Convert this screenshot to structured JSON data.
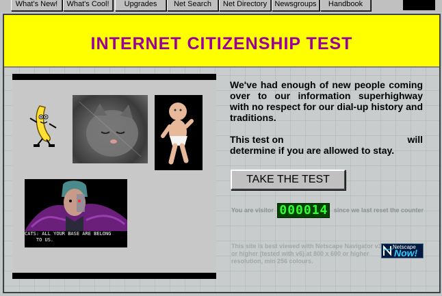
{
  "toolbar": {
    "buttons": [
      {
        "label": "What's New!"
      },
      {
        "label": "What's Cool!"
      },
      {
        "label": "Upgrades"
      },
      {
        "label": "Net Search"
      },
      {
        "label": "Net Directory"
      },
      {
        "label": "Newsgroups"
      },
      {
        "label": "Handbook"
      }
    ]
  },
  "banner": {
    "title": "INTERNET CITIZENSHIP TEST",
    "background_color": "#ffff00",
    "title_color": "#990099"
  },
  "collage": {
    "images": [
      "dancing-banana",
      "kitten",
      "dancing-baby",
      "anime-character"
    ],
    "anime_caption_line1": "CATS: ALL YOUR BASE ARE BELONG",
    "anime_caption_line2": "TO US."
  },
  "intro": {
    "paragraph1": "We've had enough of new people coming over to our information superhighway with no respect for our dial-up history and traditions.",
    "paragraph2_start": "This test on",
    "paragraph2_mid": "will",
    "paragraph2_end": "determine if you are allowed to stay."
  },
  "take_test_button": {
    "label": "TAKE THE TEST"
  },
  "visitor": {
    "prefix": "You are visitor",
    "count": "000014",
    "suffix": "since we last reset the counter"
  },
  "footer": {
    "best_viewed": "This site is best viewed with Netscape Navigator v3 or higher (tested with v6) at 800 x 600 or higher resolution, min 256 colours.",
    "badge_small": "Netscape",
    "badge_big": "Now!"
  }
}
